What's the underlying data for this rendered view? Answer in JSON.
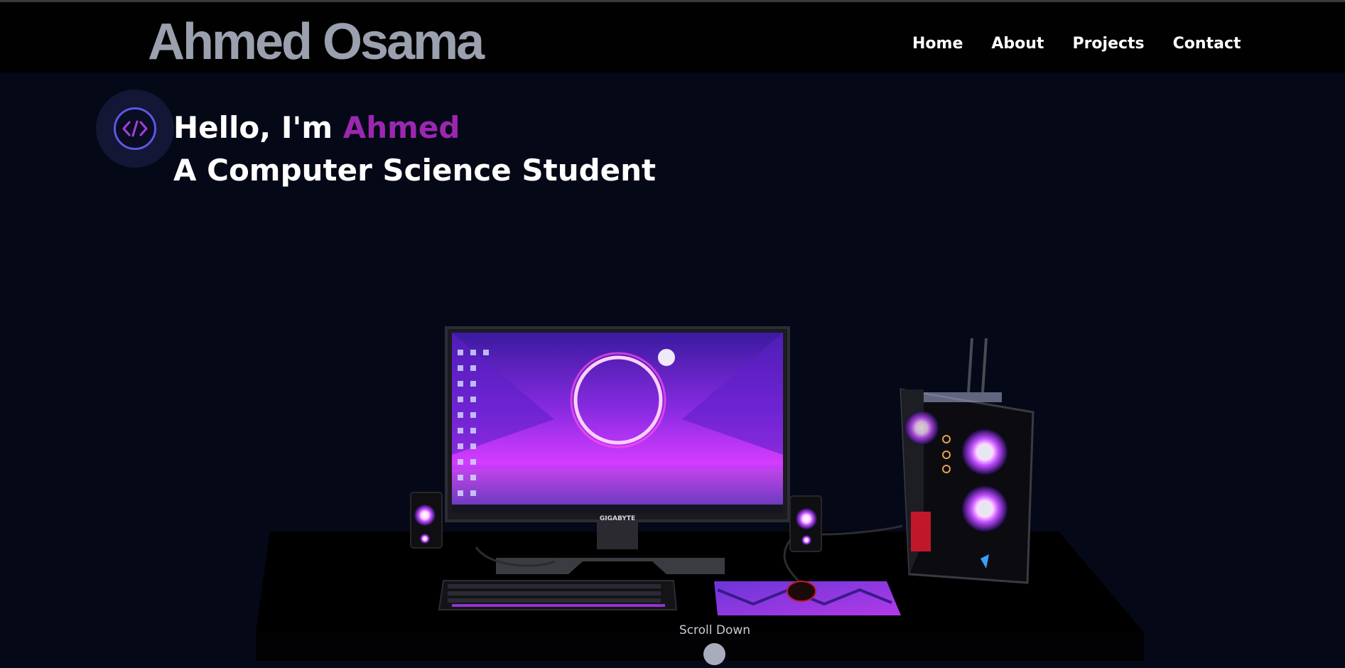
{
  "header": {
    "brand": "Ahmed Osama",
    "nav": [
      "Home",
      "About",
      "Projects",
      "Contact"
    ]
  },
  "hero": {
    "greeting_prefix": "Hello, I'm ",
    "name": "Ahmed",
    "subtitle": "A Computer Science Student",
    "badge_icon": "code-icon",
    "badge_glyph": "</>"
  },
  "scene": {
    "monitor_brand": "GIGABYTE",
    "description_icon": "desk-setup-3d"
  },
  "scroll": {
    "label": "Scroll Down"
  },
  "colors": {
    "background": "#050816",
    "navbar": "#010101",
    "brand": "#9aa0ad",
    "accent": "#9b27b0",
    "badge_ring": "#5a58e6"
  }
}
